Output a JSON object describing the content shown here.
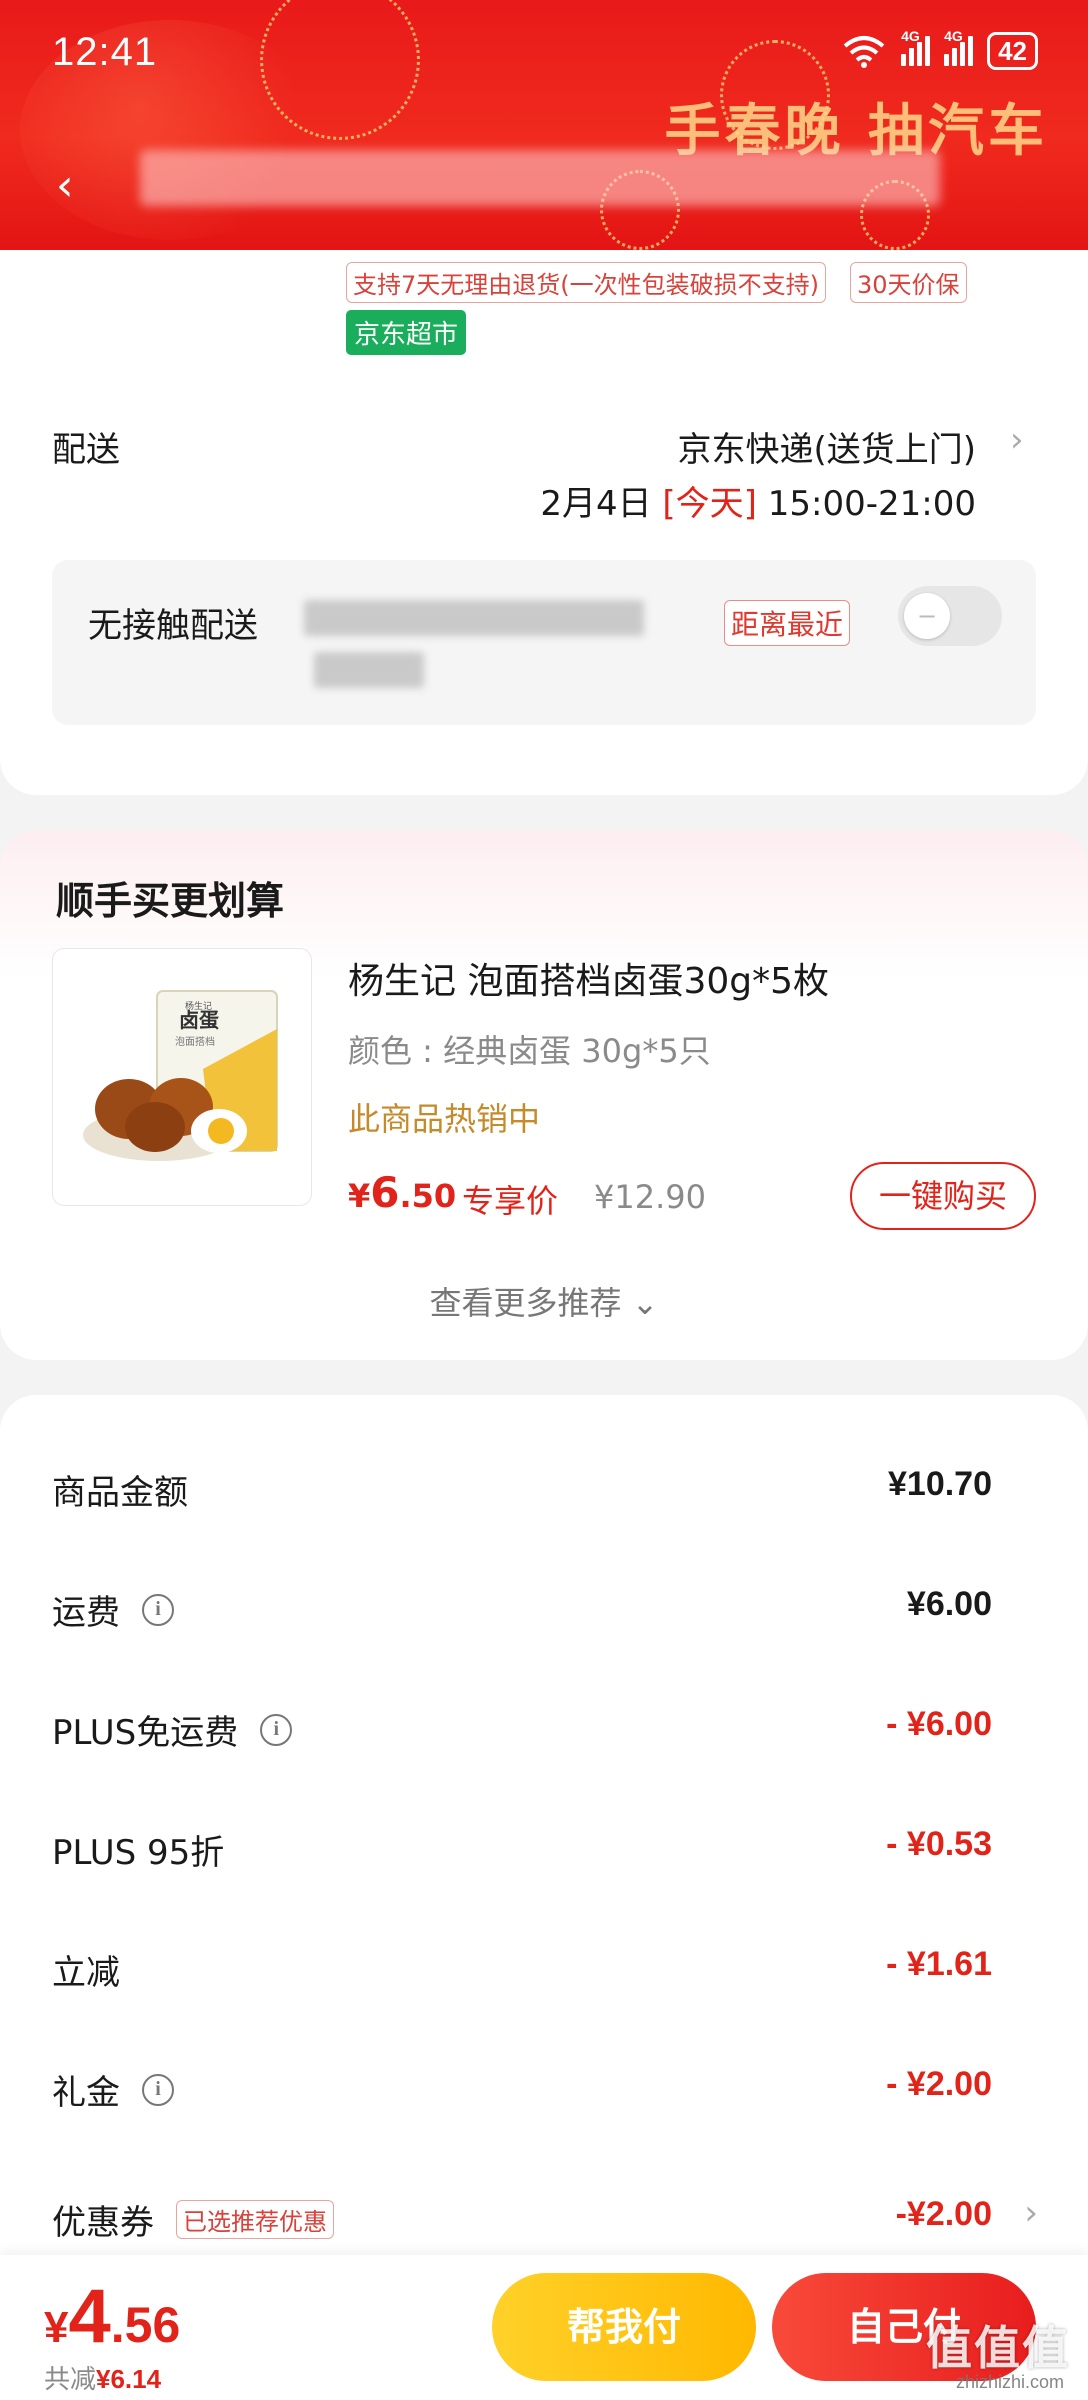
{
  "status_bar": {
    "time": "12:41",
    "net1": "6",
    "net2": "4G",
    "net3": "4G",
    "battery": "42"
  },
  "header": {
    "promo_text": "手春晚 抽汽车",
    "back_icon": "back-arrow-icon"
  },
  "service_tags": {
    "return_policy": "支持7天无理由退货(一次性包装破损不支持)",
    "price_protect": "30天价保",
    "store": "京东超市"
  },
  "delivery": {
    "label": "配送",
    "method": "京东快递(送货上门)",
    "date": "2月4日",
    "today": "[今天]",
    "time_window": "15:00-21:00",
    "contactless_label": "无接触配送",
    "nearest_tag": "距离最近"
  },
  "recommend": {
    "title": "顺手买更划算",
    "product": {
      "name": "杨生记 泡面搭档卤蛋30g*5枚",
      "spec": "颜色 : 经典卤蛋 30g*5只",
      "hot": "此商品热销中",
      "price_symbol": "¥",
      "price_int": "6",
      "price_dec": ".50",
      "exclusive_label": "专享价",
      "original_price": "¥12.90",
      "buy_button": "一键购买",
      "pkg_brand": "杨生记",
      "pkg_title": "卤蛋",
      "pkg_sub": "泡面搭档"
    },
    "more_label": "查看更多推荐 ⌄"
  },
  "costs": [
    {
      "label": "商品金额",
      "value": "¥10.70",
      "info": false,
      "red": false
    },
    {
      "label": "运费",
      "value": "¥6.00",
      "info": true,
      "red": false
    },
    {
      "label": "PLUS免运费",
      "value": "- ¥6.00",
      "info": true,
      "red": true
    },
    {
      "label": "PLUS 95折",
      "value": "- ¥0.53",
      "info": false,
      "red": true
    },
    {
      "label": "立减",
      "value": "- ¥1.61",
      "info": false,
      "red": true
    },
    {
      "label": "礼金",
      "value": "- ¥2.00",
      "info": true,
      "red": true
    }
  ],
  "coupon": {
    "label": "优惠券",
    "tag": "已选推荐优惠",
    "value": "-¥2.00"
  },
  "footer": {
    "total_symbol": "¥",
    "total_int": "4",
    "total_dec": ".56",
    "saved_label": "共减",
    "saved_value": "¥6.14",
    "pay_for_me": "帮我付",
    "pay_self": "自己付"
  },
  "watermark": {
    "main": "值值值",
    "sub": "zhizhizhi.com"
  },
  "colors": {
    "brand_red": "#e2231a",
    "header_red": "#e81a1a",
    "pay_yellow": "#ffc10a",
    "green_tag": "#1aae5c"
  }
}
